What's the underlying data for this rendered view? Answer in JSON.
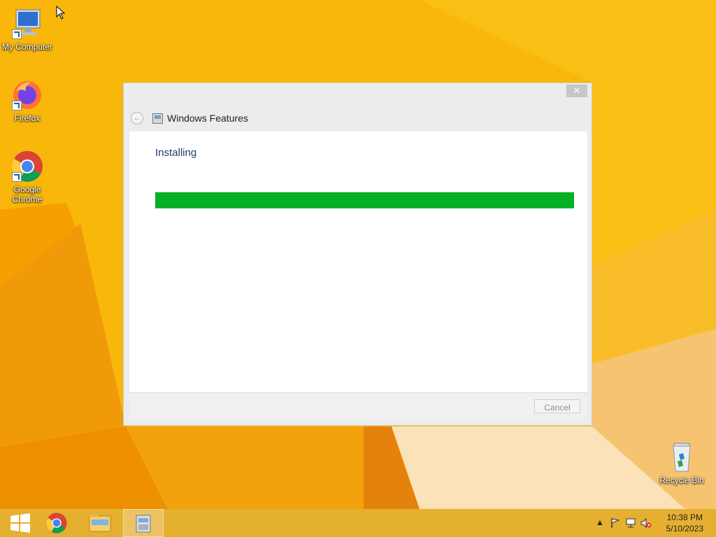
{
  "desktop": {
    "icons": [
      {
        "label": "My Computer"
      },
      {
        "label": "Firefox"
      },
      {
        "label": "Google Chrome"
      },
      {
        "label": "Recycle Bin"
      }
    ]
  },
  "dialog": {
    "title": "Windows Features",
    "close_label": "✕",
    "status": "Installing",
    "progress_fraction": 1.0,
    "cancel_label": "Cancel",
    "progress_color": "#06b025"
  },
  "taskbar": {
    "items": [
      {
        "name": "start-button",
        "icon": "windows-logo-icon"
      },
      {
        "name": "chrome",
        "icon": "chrome-icon"
      },
      {
        "name": "file-explorer",
        "icon": "folder-icon"
      },
      {
        "name": "windows-features",
        "icon": "installer-icon"
      }
    ],
    "clock": {
      "time": "10:38 PM",
      "date": "5/10/2023"
    }
  },
  "colors": {
    "wallpaper": "#f7b500"
  }
}
